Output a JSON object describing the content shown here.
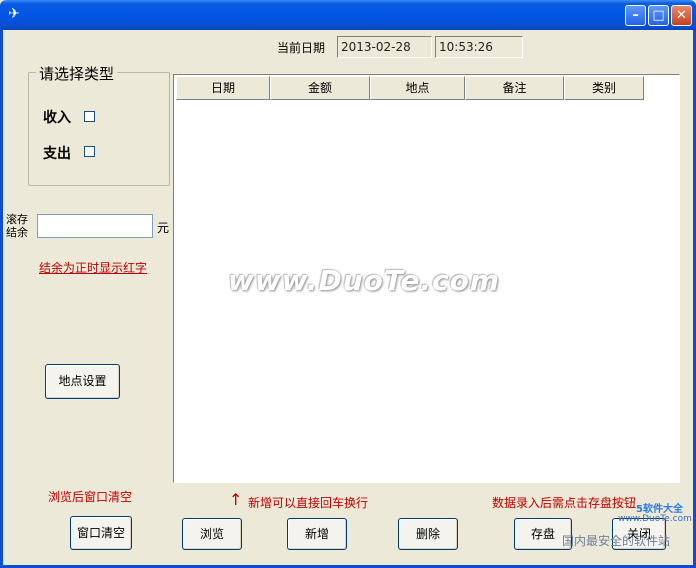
{
  "window": {
    "title": "",
    "app_icon": "app-icon",
    "controls": {
      "min": "–",
      "max": "□",
      "close": "✕"
    }
  },
  "header": {
    "date_label": "当前日期",
    "date_value": "2013-02-28",
    "time_value": "10:53:26"
  },
  "type_group": {
    "title": "请选择类型",
    "income_label": "收入",
    "expense_label": "支出",
    "income_checked": false,
    "expense_checked": false
  },
  "balance": {
    "label_line1": "滚存",
    "label_line2": "结余",
    "value": "",
    "unit": "元",
    "note": "结余为正时显示红字"
  },
  "location_button": "地点设置",
  "grid": {
    "columns": [
      "日期",
      "金额",
      "地点",
      "备注",
      "类别"
    ],
    "rows": []
  },
  "hints": {
    "browse_clear": "浏览后窗口清空",
    "arrow": "↑",
    "new_enter": "新增可以直接回车换行",
    "save_hint": "数据录入后需点击存盘按钮"
  },
  "buttons": {
    "clear": "窗口清空",
    "browse": "浏览",
    "add": "新增",
    "delete": "删除",
    "save": "存盘",
    "close": "关闭"
  },
  "watermark": {
    "main": "www.DuoTe.com",
    "corner1": "5软件大全",
    "corner2": "www.DuoTe.com",
    "corner3": "国内最安全的软件站"
  },
  "colors": {
    "titlebar": "#0055e5",
    "hint_red": "#c00000",
    "face": "#ECE9D8"
  }
}
